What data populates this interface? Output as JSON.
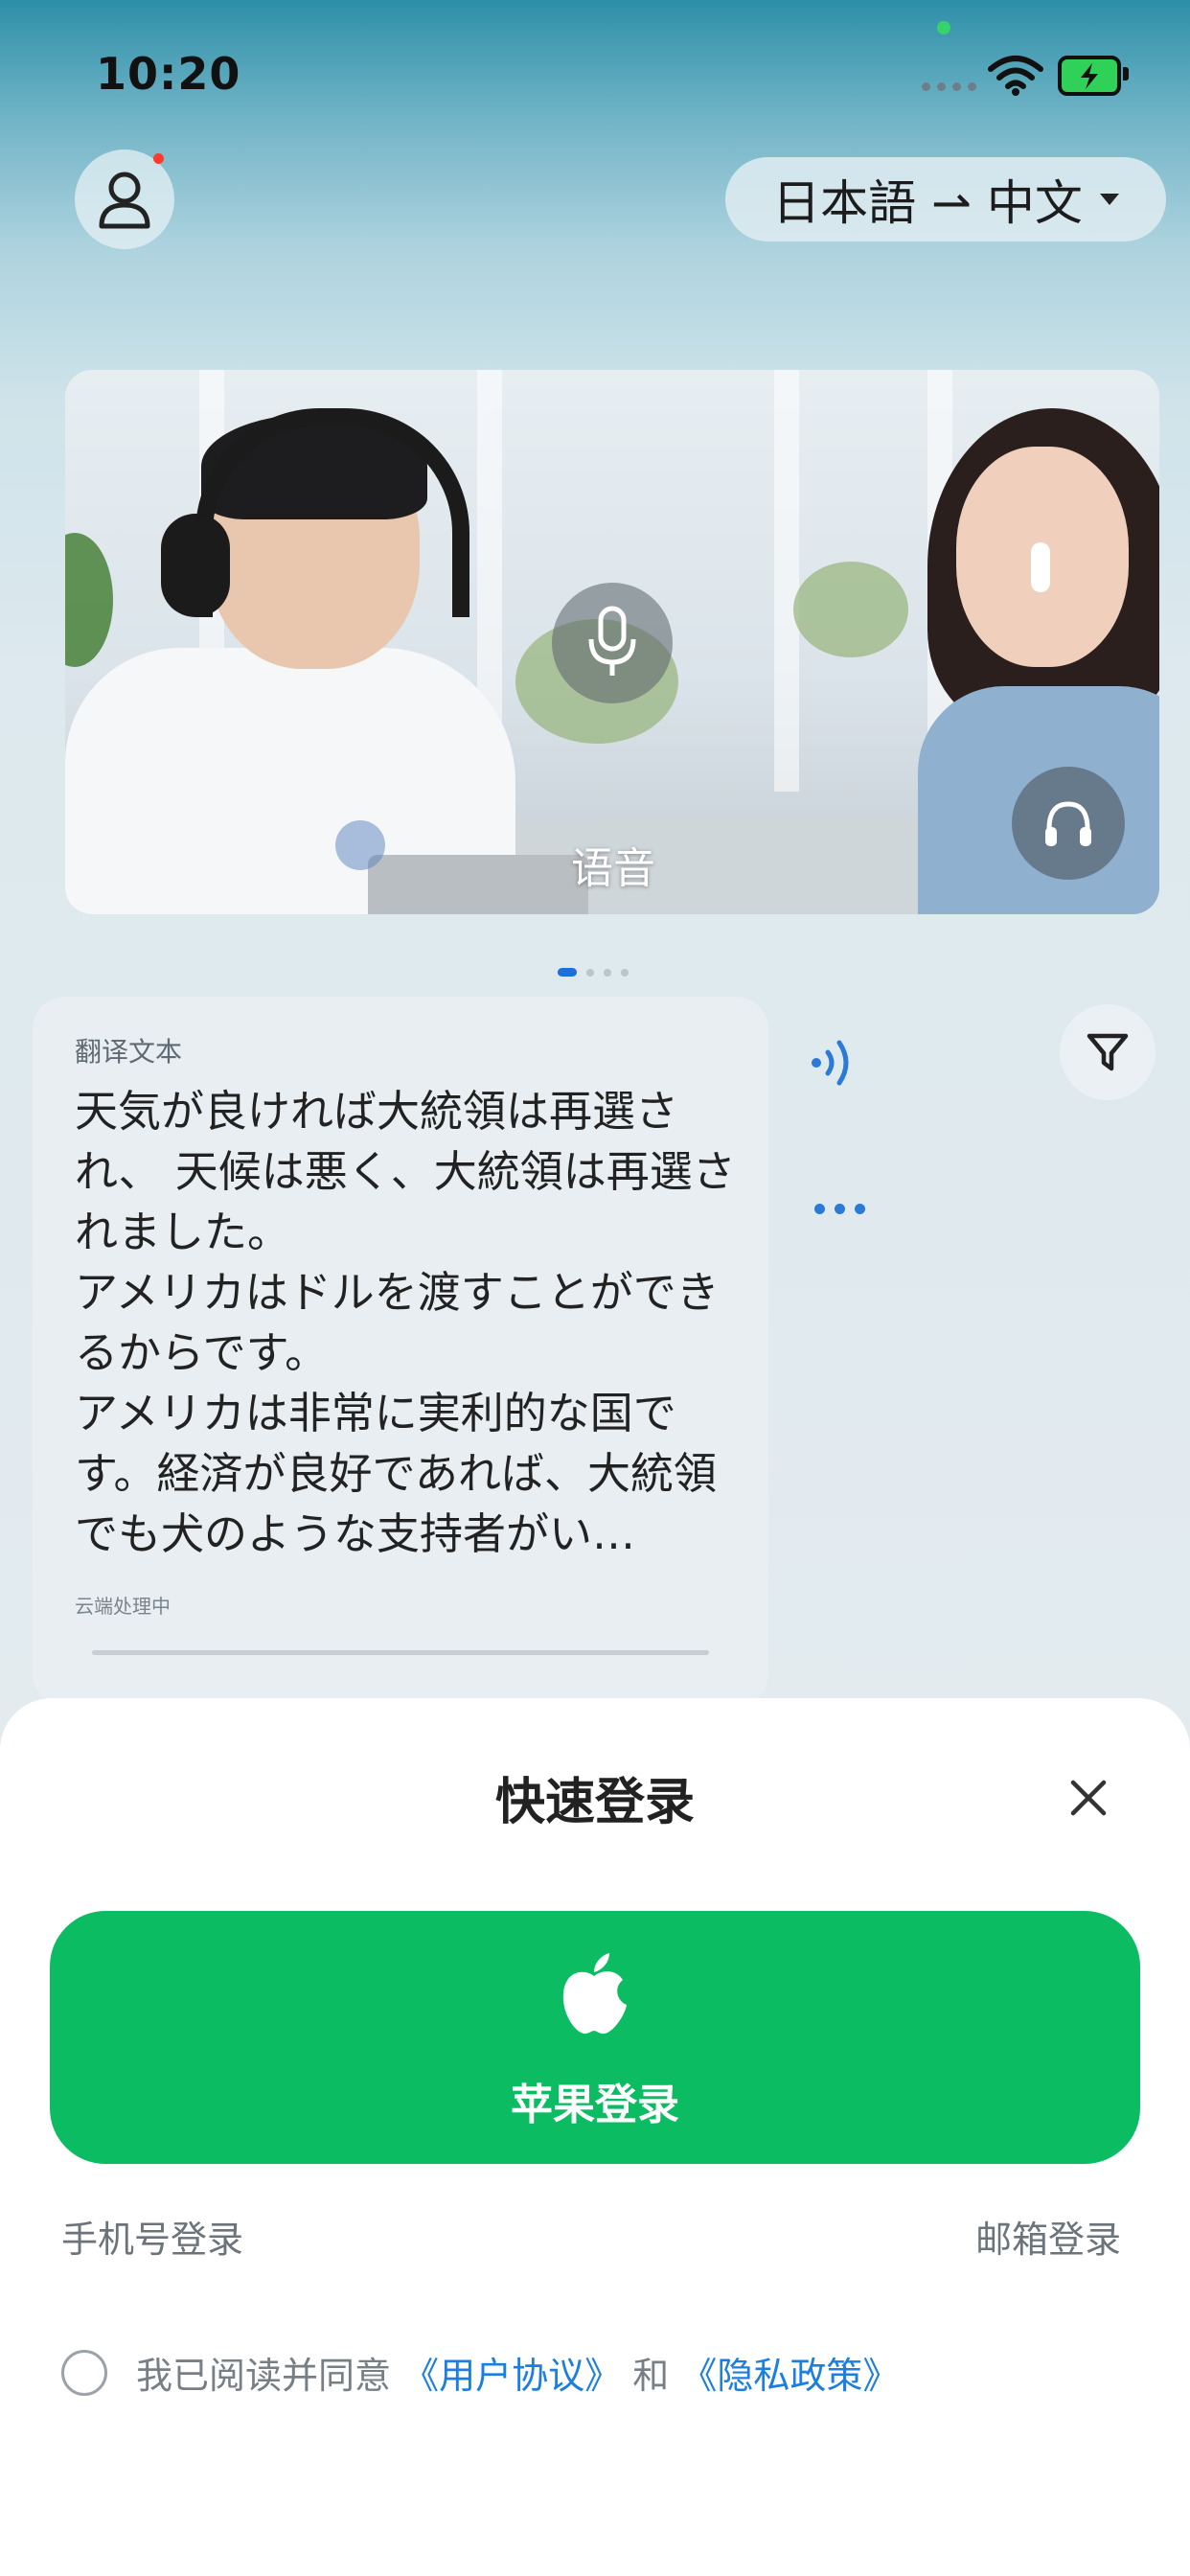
{
  "status_bar": {
    "time": "10:20"
  },
  "header": {
    "language_pair": "日本語 ⇀ 中文"
  },
  "banner": {
    "label": "语音",
    "page_count": 4,
    "active_page": 1
  },
  "translation_card": {
    "label": "翻译文本",
    "text": "天気が良ければ大統領は再選され、 天候は悪く、大統領は再選されました。\nアメリカはドルを渡すことができるからです。\nアメリカは非常に実利的な国です。経済が良好であれば、大統領でも犬のような支持者がい…",
    "status": "云端处理中"
  },
  "login_sheet": {
    "title": "快速登录",
    "apple_label": "苹果登录",
    "phone_login": "手机号登录",
    "email_login": "邮箱登录",
    "agree_prefix": "我已阅读并同意",
    "user_agreement": "《用户协议》",
    "and": "和",
    "privacy_policy": "《隐私政策》"
  },
  "colors": {
    "apple_button": "#0cbc62",
    "link": "#1c7fe0",
    "accent_blue": "#2a7ad6",
    "notification_dot": "#ff3b30"
  },
  "icons": [
    "user-icon",
    "microphone-icon",
    "headset-icon",
    "speaker-icon",
    "more-icon",
    "filter-icon",
    "close-icon",
    "apple-icon",
    "wifi-icon",
    "battery-icon"
  ]
}
